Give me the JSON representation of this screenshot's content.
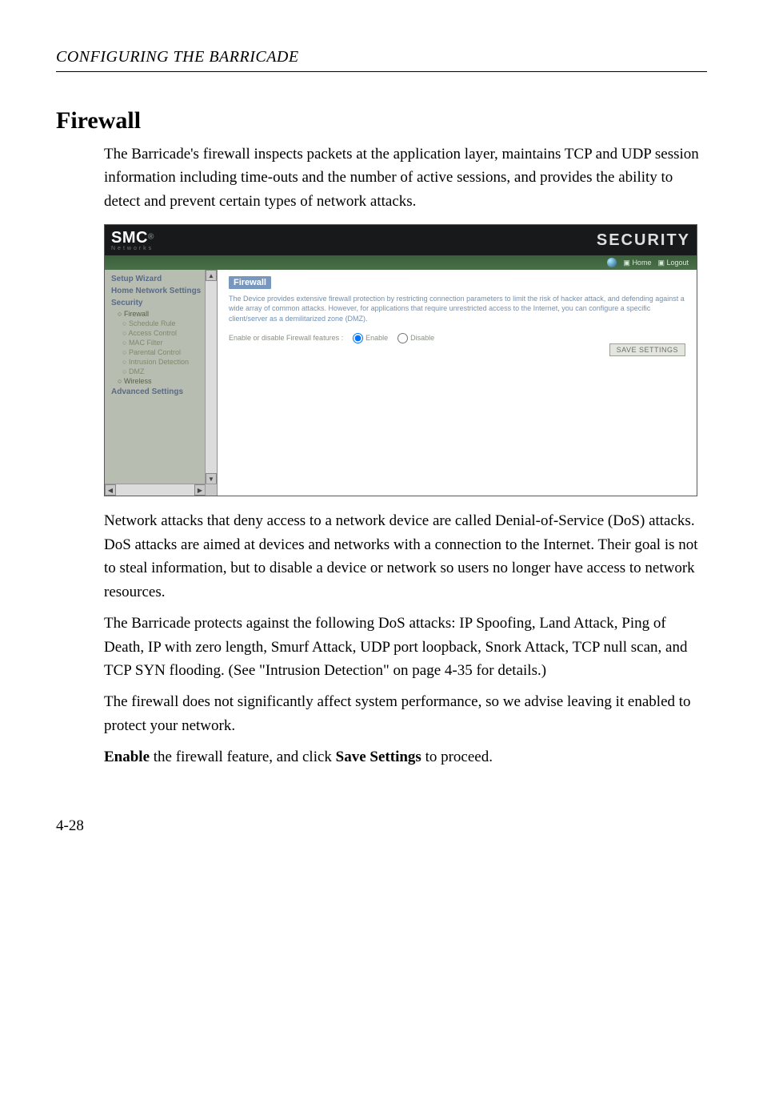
{
  "header": {
    "running_head": "CONFIGURING THE BARRICADE"
  },
  "section": {
    "title": "Firewall",
    "para1": "The Barricade's firewall inspects packets at the application layer, maintains TCP and UDP session information including time-outs and the number of active sessions, and provides the ability to detect and prevent certain types of network attacks.",
    "para2": "Network attacks that deny access to a network device are called Denial-of-Service (DoS) attacks. DoS attacks are aimed at devices and networks with a connection to the Internet. Their goal is not to steal information, but to disable a device or network so users no longer have access to network resources.",
    "para3": "The Barricade protects against the following DoS attacks: IP Spoofing, Land Attack, Ping of Death, IP with zero length, Smurf Attack, UDP port loopback, Snork Attack, TCP null scan, and TCP SYN flooding. (See \"Intrusion Detection\" on page 4-35 for details.)",
    "para4": "The firewall does not significantly affect system performance, so we advise leaving it enabled to protect your network.",
    "para5_prefix": "Enable",
    "para5_mid": " the firewall feature, and click ",
    "para5_bold2": "Save Settings",
    "para5_suffix": " to proceed."
  },
  "screenshot": {
    "logo": "SMC",
    "logo_sub": "Networks",
    "brand": "SECURITY",
    "topnav": {
      "home": "Home",
      "logout": "Logout"
    },
    "sidebar": {
      "setup_wizard": "Setup Wizard",
      "home_network_settings": "Home Network Settings",
      "security": "Security",
      "firewall": "Firewall",
      "schedule_rule": "Schedule Rule",
      "access_control": "Access Control",
      "mac_filter": "MAC Filter",
      "parental_control": "Parental Control",
      "intrusion_detection": "Intrusion Detection",
      "dmz": "DMZ",
      "wireless": "Wireless",
      "advanced_settings": "Advanced Settings"
    },
    "main": {
      "title": "Firewall",
      "desc": "The Device provides extensive firewall protection by restricting connection parameters to limit the risk of hacker attack, and defending against a wide array of common attacks. However, for applications that require unrestricted access to the Internet, you can configure a specific client/server as a demilitarized zone (DMZ).",
      "row_label": "Enable or disable Firewall features :",
      "enable": "Enable",
      "disable": "Disable",
      "save": "SAVE SETTINGS"
    }
  },
  "page_number": "4-28"
}
